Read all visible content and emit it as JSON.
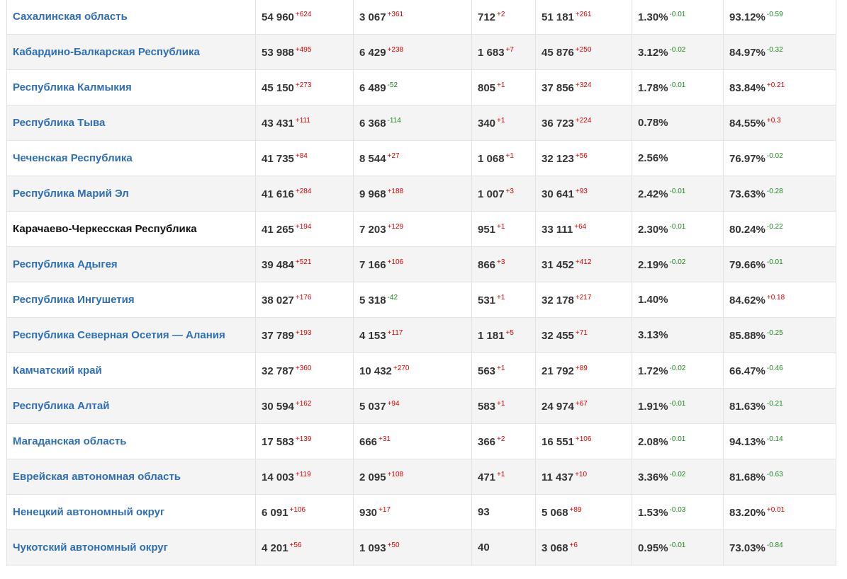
{
  "colors": {
    "link": "#2f6fb5",
    "increase": "#e00000",
    "decrease": "#1a8a1a"
  },
  "rows": [
    {
      "region": "Сахалинская область",
      "link": true,
      "c1": [
        "54 960",
        "+624"
      ],
      "c2": [
        "3 067",
        "+361"
      ],
      "c3": [
        "712",
        "+2"
      ],
      "c4": [
        "51 181",
        "+261"
      ],
      "c5": [
        "1.30%",
        "-0.01"
      ],
      "c6": [
        "93.12%",
        "-0.59"
      ]
    },
    {
      "region": "Кабардино-Балкарская Республика",
      "link": true,
      "c1": [
        "53 988",
        "+495"
      ],
      "c2": [
        "6 429",
        "+238"
      ],
      "c3": [
        "1 683",
        "+7"
      ],
      "c4": [
        "45 876",
        "+250"
      ],
      "c5": [
        "3.12%",
        "-0.02"
      ],
      "c6": [
        "84.97%",
        "-0.32"
      ]
    },
    {
      "region": "Республика Калмыкия",
      "link": true,
      "c1": [
        "45 150",
        "+273"
      ],
      "c2": [
        "6 489",
        "-52"
      ],
      "c3": [
        "805",
        "+1"
      ],
      "c4": [
        "37 856",
        "+324"
      ],
      "c5": [
        "1.78%",
        "-0.01"
      ],
      "c6": [
        "83.84%",
        "+0.21"
      ]
    },
    {
      "region": "Республика Тыва",
      "link": true,
      "c1": [
        "43 431",
        "+111"
      ],
      "c2": [
        "6 368",
        "-114"
      ],
      "c3": [
        "340",
        "+1"
      ],
      "c4": [
        "36 723",
        "+224"
      ],
      "c5": [
        "0.78%",
        ""
      ],
      "c6": [
        "84.55%",
        "+0.3"
      ]
    },
    {
      "region": "Чеченская Республика",
      "link": true,
      "c1": [
        "41 735",
        "+84"
      ],
      "c2": [
        "8 544",
        "+27"
      ],
      "c3": [
        "1 068",
        "+1"
      ],
      "c4": [
        "32 123",
        "+56"
      ],
      "c5": [
        "2.56%",
        ""
      ],
      "c6": [
        "76.97%",
        "-0.02"
      ]
    },
    {
      "region": "Республика Марий Эл",
      "link": true,
      "c1": [
        "41 616",
        "+284"
      ],
      "c2": [
        "9 968",
        "+188"
      ],
      "c3": [
        "1 007",
        "+3"
      ],
      "c4": [
        "30 641",
        "+93"
      ],
      "c5": [
        "2.42%",
        "-0.01"
      ],
      "c6": [
        "73.63%",
        "-0.28"
      ]
    },
    {
      "region": "Карачаево-Черкесская Республика",
      "link": false,
      "c1": [
        "41 265",
        "+194"
      ],
      "c2": [
        "7 203",
        "+129"
      ],
      "c3": [
        "951",
        "+1"
      ],
      "c4": [
        "33 111",
        "+64"
      ],
      "c5": [
        "2.30%",
        "-0.01"
      ],
      "c6": [
        "80.24%",
        "-0.22"
      ]
    },
    {
      "region": "Республика Адыгея",
      "link": true,
      "c1": [
        "39 484",
        "+521"
      ],
      "c2": [
        "7 166",
        "+106"
      ],
      "c3": [
        "866",
        "+3"
      ],
      "c4": [
        "31 452",
        "+412"
      ],
      "c5": [
        "2.19%",
        "-0.02"
      ],
      "c6": [
        "79.66%",
        "-0.01"
      ]
    },
    {
      "region": "Республика Ингушетия",
      "link": true,
      "c1": [
        "38 027",
        "+176"
      ],
      "c2": [
        "5 318",
        "-42"
      ],
      "c3": [
        "531",
        "+1"
      ],
      "c4": [
        "32 178",
        "+217"
      ],
      "c5": [
        "1.40%",
        ""
      ],
      "c6": [
        "84.62%",
        "+0.18"
      ]
    },
    {
      "region": "Республика Северная Осетия — Алания",
      "link": true,
      "c1": [
        "37 789",
        "+193"
      ],
      "c2": [
        "4 153",
        "+117"
      ],
      "c3": [
        "1 181",
        "+5"
      ],
      "c4": [
        "32 455",
        "+71"
      ],
      "c5": [
        "3.13%",
        ""
      ],
      "c6": [
        "85.88%",
        "-0.25"
      ]
    },
    {
      "region": "Камчатский край",
      "link": true,
      "c1": [
        "32 787",
        "+360"
      ],
      "c2": [
        "10 432",
        "+270"
      ],
      "c3": [
        "563",
        "+1"
      ],
      "c4": [
        "21 792",
        "+89"
      ],
      "c5": [
        "1.72%",
        "-0.02"
      ],
      "c6": [
        "66.47%",
        "-0.46"
      ]
    },
    {
      "region": "Республика Алтай",
      "link": true,
      "c1": [
        "30 594",
        "+162"
      ],
      "c2": [
        "5 037",
        "+94"
      ],
      "c3": [
        "583",
        "+1"
      ],
      "c4": [
        "24 974",
        "+67"
      ],
      "c5": [
        "1.91%",
        "-0.01"
      ],
      "c6": [
        "81.63%",
        "-0.21"
      ]
    },
    {
      "region": "Магаданская область",
      "link": true,
      "c1": [
        "17 583",
        "+139"
      ],
      "c2": [
        "666",
        "+31"
      ],
      "c3": [
        "366",
        "+2"
      ],
      "c4": [
        "16 551",
        "+106"
      ],
      "c5": [
        "2.08%",
        "-0.01"
      ],
      "c6": [
        "94.13%",
        "-0.14"
      ]
    },
    {
      "region": "Еврейская автономная область",
      "link": true,
      "c1": [
        "14 003",
        "+119"
      ],
      "c2": [
        "2 095",
        "+108"
      ],
      "c3": [
        "471",
        "+1"
      ],
      "c4": [
        "11 437",
        "+10"
      ],
      "c5": [
        "3.36%",
        "-0.02"
      ],
      "c6": [
        "81.68%",
        "-0.63"
      ]
    },
    {
      "region": "Ненецкий автономный округ",
      "link": true,
      "c1": [
        "6 091",
        "+106"
      ],
      "c2": [
        "930",
        "+17"
      ],
      "c3": [
        "93",
        ""
      ],
      "c4": [
        "5 068",
        "+89"
      ],
      "c5": [
        "1.53%",
        "-0.03"
      ],
      "c6": [
        "83.20%",
        "+0.01"
      ]
    },
    {
      "region": "Чукотский автономный округ",
      "link": true,
      "c1": [
        "4 201",
        "+56"
      ],
      "c2": [
        "1 093",
        "+50"
      ],
      "c3": [
        "40",
        ""
      ],
      "c4": [
        "3 068",
        "+6"
      ],
      "c5": [
        "0.95%",
        "-0.01"
      ],
      "c6": [
        "73.03%",
        "-0.84"
      ]
    }
  ]
}
